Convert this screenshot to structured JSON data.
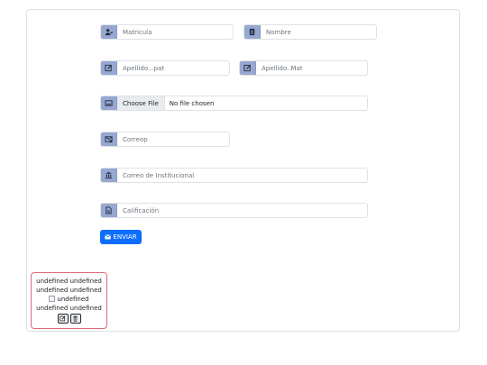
{
  "form": {
    "matricula": {
      "placeholder": "Matricula",
      "icon": "id-badge-icon"
    },
    "nombre": {
      "placeholder": "Nombre",
      "icon": "person-badge-icon"
    },
    "apellido_pat": {
      "placeholder": "Apellido...pat",
      "icon": "pencil-square-icon"
    },
    "apellido_mat": {
      "placeholder": "Apellido..Mat",
      "icon": "pencil-square-icon"
    },
    "foto": {
      "button_label": "Choose File",
      "status": "No file chosen",
      "icon": "image-icon"
    },
    "correo": {
      "placeholder": "Correop",
      "icon": "envelope-at-icon"
    },
    "correo_institucional": {
      "placeholder": "Correo de Institucional",
      "icon": "bank-icon"
    },
    "calificacion": {
      "placeholder": "Calificación",
      "icon": "file-text-icon"
    },
    "submit_label": "ENVIAR"
  },
  "result_card": {
    "line1": "undefined undefined",
    "line2": "undefined undefined",
    "image_alt": "undefined",
    "line4": "undefined undefined",
    "edit_icon": "edit-icon",
    "delete_icon": "trash-icon"
  },
  "colors": {
    "addon_bg": "#98a7cf",
    "primary": "#0d6efd",
    "card_border": "#dc6a78"
  }
}
